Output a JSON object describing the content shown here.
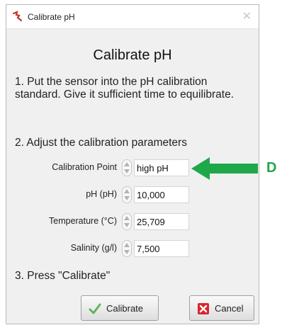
{
  "window": {
    "title": "Calibrate pH",
    "close_glyph": "✕"
  },
  "heading": "Calibrate pH",
  "steps": {
    "step1": "1. Put the sensor into the pH calibration standard. Give it sufficient time to equilibrate.",
    "step2": "2. Adjust the calibration parameters",
    "step3": "3. Press \"Calibrate\""
  },
  "params": {
    "calibration_point": {
      "label": "Calibration Point",
      "value": "high pH"
    },
    "ph": {
      "label": "pH (pH)",
      "value": "10,000"
    },
    "temperature": {
      "label": "Temperature (°C)",
      "value": "25,709"
    },
    "salinity": {
      "label": "Salinity (g/l)",
      "value": "7,500"
    }
  },
  "buttons": {
    "calibrate": "Calibrate",
    "cancel": "Cancel"
  },
  "annotation": {
    "label": "D",
    "color": "#1fa84a"
  },
  "icons": {
    "app": "app-logo-icon",
    "spinner": "spinner-arrows-icon",
    "calibrate": "check-icon",
    "cancel": "red-x-icon"
  }
}
